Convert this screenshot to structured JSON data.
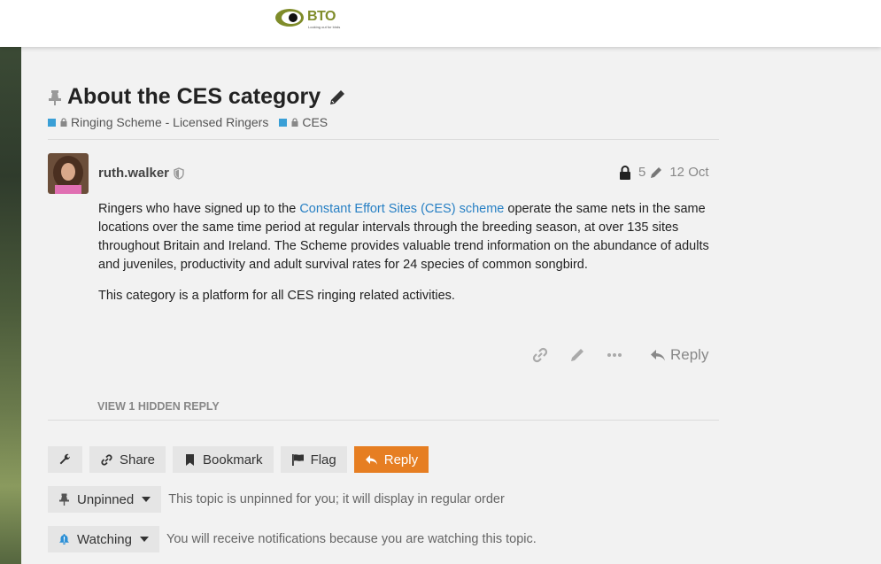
{
  "header": {
    "logo_text": "BTO",
    "logo_tagline": "Looking out for birds"
  },
  "topic": {
    "title": "About the CES category",
    "categories": [
      {
        "label": "Ringing Scheme - Licensed Ringers",
        "color": "#3a9fd6"
      },
      {
        "label": "CES",
        "color": "#3a9fd6"
      }
    ]
  },
  "post": {
    "username": "ruth.walker",
    "edit_count": "5",
    "date": "12 Oct",
    "body_p1_before": "Ringers who have signed up to the ",
    "body_p1_link": "Constant Effort Sites (CES) scheme",
    "body_p1_after": " operate the same nets in the same locations over the same time period at regular intervals through the breeding season, at over 135 sites throughout Britain and Ireland. The Scheme provides valuable trend information on the abundance of adults and juveniles, productivity and adult survival rates for 24 species of common songbird.",
    "body_p2": "This category is a platform for all CES ringing related activities.",
    "reply_label": "Reply"
  },
  "hidden_reply_label": "VIEW 1 HIDDEN REPLY",
  "controls": {
    "share": "Share",
    "bookmark": "Bookmark",
    "flag": "Flag",
    "reply": "Reply"
  },
  "pin_status": {
    "label": "Unpinned",
    "description": "This topic is unpinned for you; it will display in regular order"
  },
  "notification": {
    "label": "Watching",
    "description": "You will receive notifications because you are watching this topic."
  },
  "colors": {
    "accent": "#e67e22",
    "link": "#2880c4",
    "category": "#3a9fd6",
    "brand": "#7f8c2a"
  }
}
